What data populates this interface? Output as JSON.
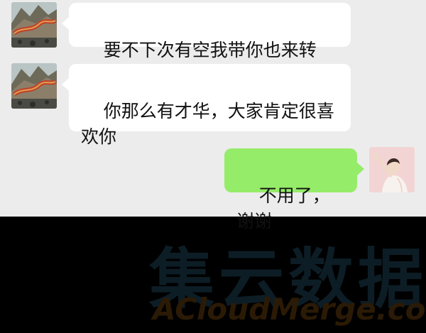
{
  "chat": {
    "messages": [
      {
        "sender": "contact",
        "avatar_icon": "great-wall-painting-avatar-icon",
        "text": "要不下次有空我带你也来转转?"
      },
      {
        "sender": "contact",
        "avatar_icon": "great-wall-painting-avatar-icon",
        "text": "你那么有才华，大家肯定很喜欢你"
      },
      {
        "sender": "self",
        "avatar_icon": "woman-portrait-avatar-icon",
        "text": "不用了，谢谢"
      }
    ]
  },
  "watermark": {
    "cn_text": "集云数据",
    "en_text": "ACloudMerge.com"
  },
  "colors": {
    "chat_background": "#ececec",
    "incoming_bubble": "#ffffff",
    "outgoing_bubble": "#95ec69",
    "footer_background": "#000000"
  }
}
